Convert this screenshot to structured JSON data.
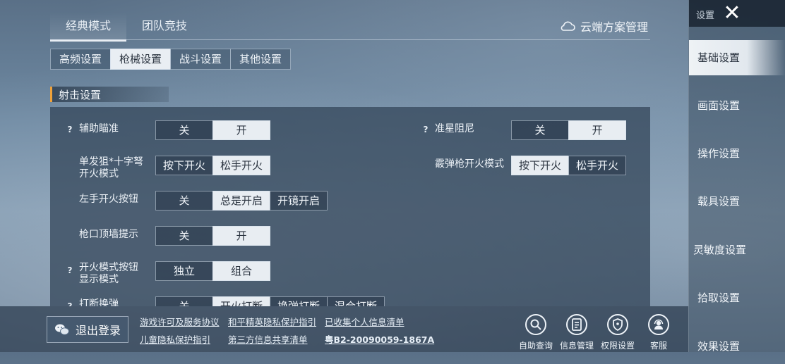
{
  "mode_tabs": [
    "经典模式",
    "团队竞技"
  ],
  "cloud_manage": "云端方案管理",
  "sub_tabs": [
    "高频设置",
    "枪械设置",
    "战斗设置",
    "其他设置"
  ],
  "section_title": "射击设置",
  "settings": {
    "aim_assist": {
      "label": "辅助瞄准",
      "options": [
        "关",
        "开"
      ],
      "selected": "开"
    },
    "crosshair_damping": {
      "label": "准星阻尼",
      "options": [
        "关",
        "开"
      ],
      "selected": "开"
    },
    "single_sniper_fire": {
      "label_line1": "单发狙*十字弩",
      "label_line2": "开火模式",
      "options": [
        "按下开火",
        "松手开火"
      ],
      "selected": "松手开火"
    },
    "shotgun_fire": {
      "label": "霰弹枪开火模式",
      "options": [
        "按下开火",
        "松手开火"
      ],
      "selected": "按下开火"
    },
    "left_fire": {
      "label": "左手开火按钮",
      "options": [
        "关",
        "总是开启",
        "开镜开启"
      ],
      "selected": "总是开启"
    },
    "muzzle_wall": {
      "label": "枪口顶墙提示",
      "options": [
        "关",
        "开"
      ],
      "selected": "开"
    },
    "fire_mode_button": {
      "label_line1": "开火模式按钮",
      "label_line2": "显示模式",
      "options": [
        "独立",
        "组合"
      ],
      "selected": "组合"
    },
    "partial_row": {
      "label": "打断换弹",
      "options": [
        "关",
        "开火打断",
        "换弹打断",
        "混合打断"
      ]
    }
  },
  "sidebar": {
    "header": "设置",
    "items": [
      "基础设置",
      "画面设置",
      "操作设置",
      "载具设置",
      "灵敏度设置",
      "拾取设置",
      "效果设置"
    ],
    "active": "基础设置"
  },
  "bottom": {
    "logout": "退出登录",
    "links": [
      "游戏许可及服务协议",
      "和平精英隐私保护指引",
      "已收集个人信息清单",
      "儿童隐私保护指引",
      "第三方信息共享清单",
      "粤B2-20090059-1867A"
    ],
    "buttons": [
      {
        "label": "自助查询",
        "icon": "search-icon"
      },
      {
        "label": "信息管理",
        "icon": "document-icon"
      },
      {
        "label": "权限设置",
        "icon": "shield-icon"
      },
      {
        "label": "客服",
        "icon": "headset-icon"
      }
    ]
  },
  "colors": {
    "accent": "#f0a23a",
    "selected_bg": "#e8edf2"
  }
}
